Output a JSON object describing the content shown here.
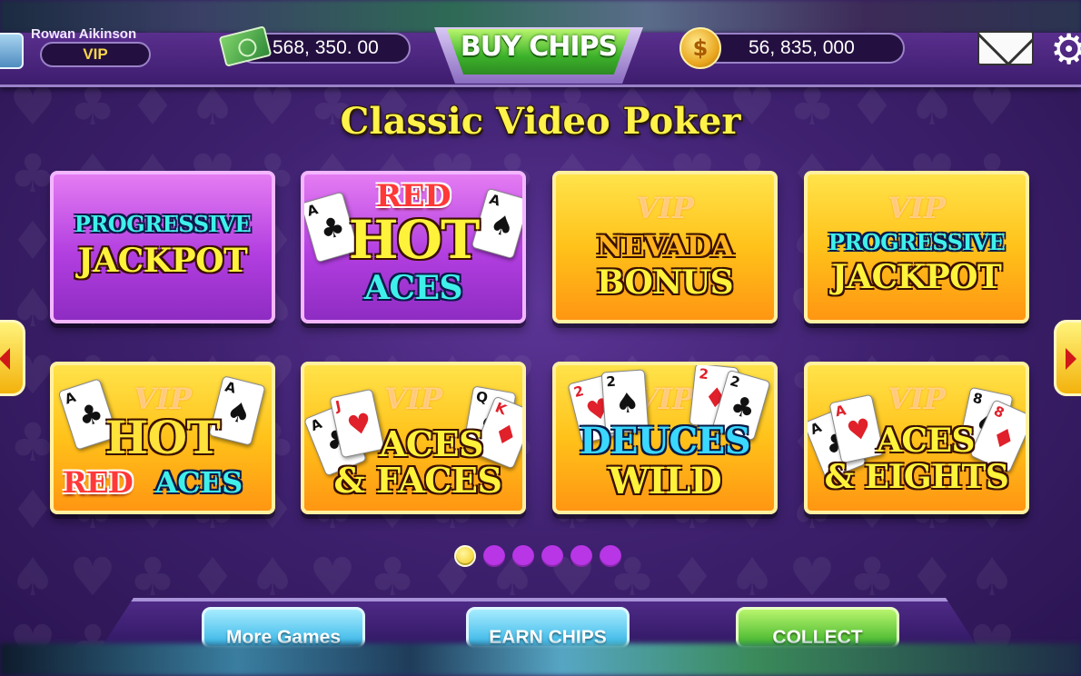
{
  "header": {
    "player_name": "Rowan Aikinson",
    "vip_label": "VIP",
    "cash_amount": "568, 350. 00",
    "buy_chips_label": "BUY CHIPS",
    "coin_amount": "56, 835, 000",
    "coin_symbol": "$",
    "icons": [
      "cash-icon",
      "coin-icon",
      "mail-icon",
      "gear-icon"
    ]
  },
  "section_title": "Classic Video Poker",
  "games": [
    {
      "vip": "",
      "lines": [
        "PROGRESSIVE",
        "JACKPOT"
      ],
      "theme": "purple"
    },
    {
      "vip": "",
      "lines": [
        "RED",
        "HOT",
        "ACES"
      ],
      "theme": "purple"
    },
    {
      "vip": "VIP",
      "lines": [
        "NEVADA",
        "BONUS"
      ],
      "theme": "gold"
    },
    {
      "vip": "VIP",
      "lines": [
        "PROGRESSIVE",
        "JACKPOT"
      ],
      "theme": "gold"
    },
    {
      "vip": "VIP",
      "lines": [
        "HOT",
        "RED",
        "ACES"
      ],
      "theme": "gold"
    },
    {
      "vip": "VIP",
      "lines": [
        "ACES",
        "& FACES"
      ],
      "theme": "gold"
    },
    {
      "vip": "VIP",
      "lines": [
        "DEUCES",
        "WILD"
      ],
      "theme": "gold"
    },
    {
      "vip": "VIP",
      "lines": [
        "ACES",
        "& EIGHTS"
      ],
      "theme": "gold"
    }
  ],
  "cards": {
    "ace": "A",
    "two": "2",
    "eight": "8",
    "queen": "Q",
    "jack": "J",
    "king": "K",
    "spade": "♠",
    "club": "♣",
    "heart": "♥",
    "diamond": "♦"
  },
  "pagination": {
    "total": 6,
    "current": 1
  },
  "footer": {
    "more_games_label": "More Games",
    "earn_chips_label": "EARN CHIPS",
    "collect_label": "COLLECT"
  },
  "colors": {
    "background": "#3f2170",
    "title_yellow": "#fff24a",
    "tile_purple": "#b23ee0",
    "tile_gold": "#ffc21a",
    "button_green": "#3cb22a",
    "button_blue": "#34b4e6"
  }
}
